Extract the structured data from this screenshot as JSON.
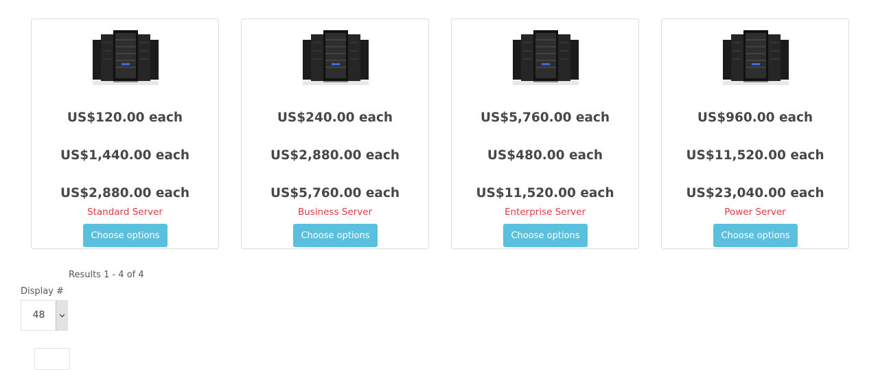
{
  "products": [
    {
      "name": "Standard Server",
      "image_icon": "server-rack-icon",
      "prices": [
        "US$120.00 each",
        "US$1,440.00 each",
        "US$2,880.00 each"
      ],
      "button_label": "Choose options"
    },
    {
      "name": "Business Server",
      "image_icon": "server-rack-icon",
      "prices": [
        "US$240.00 each",
        "US$2,880.00 each",
        "US$5,760.00 each"
      ],
      "button_label": "Choose options"
    },
    {
      "name": "Enterprise Server",
      "image_icon": "server-rack-icon",
      "prices": [
        "US$5,760.00 each",
        "US$480.00 each",
        "US$11,520.00 each"
      ],
      "button_label": "Choose options"
    },
    {
      "name": "Power Server",
      "image_icon": "server-rack-icon",
      "prices": [
        "US$960.00 each",
        "US$11,520.00 each",
        "US$23,040.00 each"
      ],
      "button_label": "Choose options"
    }
  ],
  "pagination": {
    "results_text": "Results 1 - 4 of 4",
    "display_label": "Display #",
    "display_value": "48"
  },
  "colors": {
    "button_bg": "#5bc0de",
    "product_name": "#e0393e",
    "price_text": "#474747"
  }
}
